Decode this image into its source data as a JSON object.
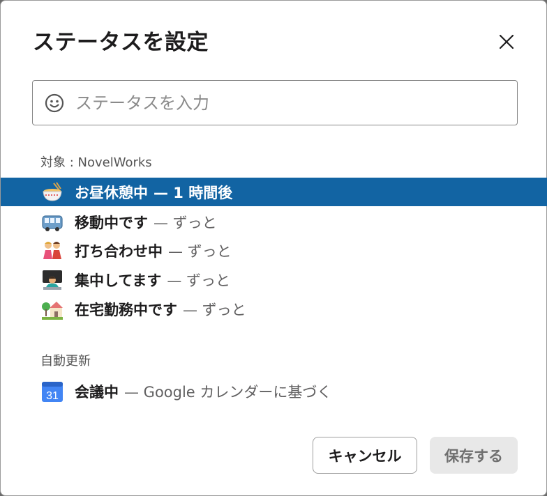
{
  "dialog": {
    "title": "ステータスを設定",
    "close_icon": "close-icon"
  },
  "search": {
    "placeholder": "ステータスを入力",
    "value": "",
    "icon": "smiley-icon"
  },
  "presets": {
    "label": "対象 : NovelWorks",
    "items": [
      {
        "icon": "ramen-bowl-icon",
        "name": "お昼休憩中",
        "duration": "— 1 時間後",
        "selected": true
      },
      {
        "icon": "bus-icon",
        "name": "移動中です",
        "duration": "— ずっと",
        "selected": false
      },
      {
        "icon": "people-meeting-icon",
        "name": "打ち合わせ中",
        "duration": "— ずっと",
        "selected": false
      },
      {
        "icon": "technologist-icon",
        "name": "集中してます",
        "duration": "— ずっと",
        "selected": false
      },
      {
        "icon": "house-with-garden-icon",
        "name": "在宅勤務中です",
        "duration": "— ずっと",
        "selected": false
      }
    ]
  },
  "auto": {
    "label": "自動更新",
    "items": [
      {
        "icon": "calendar-31-icon",
        "icon_text": "31",
        "name": "会議中",
        "duration": "— Google カレンダーに基づく"
      }
    ]
  },
  "footer": {
    "cancel_label": "キャンセル",
    "save_label": "保存する"
  },
  "colors": {
    "selected_bg": "#1264a3",
    "text": "#1d1c1d",
    "muted": "#616061"
  }
}
